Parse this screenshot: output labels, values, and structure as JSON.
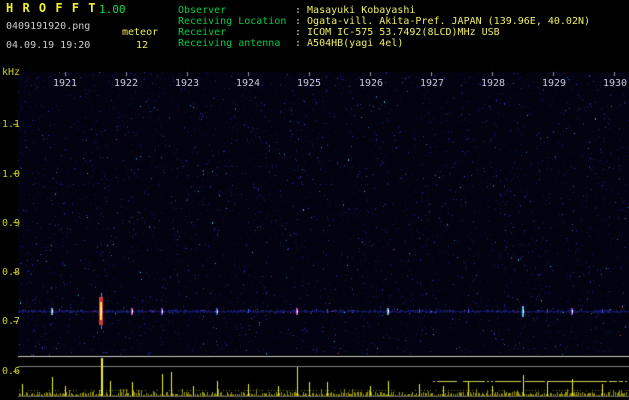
{
  "app": {
    "title": "H R O F F T",
    "version": "1.00",
    "filename": "0409191920.png",
    "mode": "meteor",
    "timestamp": "04.09.19 19:20",
    "event_count": "12"
  },
  "info": {
    "rows": [
      {
        "label": "Observer",
        "value": ": Masayuki Kobayashi"
      },
      {
        "label": "Receiving Location",
        "value": ": Ogata-vill. Akita-Pref. JAPAN (139.96E, 40.02N)"
      },
      {
        "label": "Receiver",
        "value": ": ICOM IC-575 53.7492(8LCD)MHz USB"
      },
      {
        "label": "Receiving antenna",
        "value": ": A504HB(yagi 4el)"
      }
    ]
  },
  "colors": {
    "title_yellow": "#eeee33",
    "label_green": "#00cc44",
    "value_yellow": "#eeee66",
    "axis_yellow": "#cccc22",
    "time_label": "#c8c8dc",
    "spike_yellow": "#eeee22",
    "separator": "#cccccc"
  },
  "chart_data": {
    "type": "heatmap",
    "title": "HROFFT 10-minute meteor radio spectrogram 19:20-19:30 with signal-level strip",
    "x_axis": {
      "unit": "hhmm",
      "tick_labels": [
        "1921",
        "1922",
        "1923",
        "1924",
        "1925",
        "1926",
        "1927",
        "1928",
        "1929",
        "1930"
      ]
    },
    "y_axis": {
      "unit": "kHz",
      "tick_labels": [
        "1.1",
        "1.0",
        "0.9",
        "0.8",
        "0.7",
        "0.6"
      ],
      "tick_values": [
        1.1,
        1.0,
        0.9,
        0.8,
        0.7,
        0.6
      ],
      "range_khz": [
        0.59,
        1.17
      ]
    },
    "carrier_freq_khz": 0.72,
    "echoes": [
      {
        "time": 1920.8,
        "freq_khz": 0.72,
        "strength": "small",
        "color": "cyan"
      },
      {
        "time": 1921.6,
        "freq_khz": 0.72,
        "strength": "large",
        "color": "red"
      },
      {
        "time": 1922.1,
        "freq_khz": 0.72,
        "strength": "small",
        "color": "magenta"
      },
      {
        "time": 1922.6,
        "freq_khz": 0.72,
        "strength": "small",
        "color": "purple"
      },
      {
        "time": 1923.5,
        "freq_khz": 0.72,
        "strength": "small",
        "color": "blue"
      },
      {
        "time": 1924.0,
        "freq_khz": 0.72,
        "strength": "faint",
        "color": "blue"
      },
      {
        "time": 1924.8,
        "freq_khz": 0.72,
        "strength": "small",
        "color": "magenta"
      },
      {
        "time": 1925.3,
        "freq_khz": 0.72,
        "strength": "faint",
        "color": "blue"
      },
      {
        "time": 1926.3,
        "freq_khz": 0.72,
        "strength": "small",
        "color": "cyan"
      },
      {
        "time": 1926.8,
        "freq_khz": 0.72,
        "strength": "faint",
        "color": "blue"
      },
      {
        "time": 1927.6,
        "freq_khz": 0.72,
        "strength": "faint",
        "color": "blue"
      },
      {
        "time": 1928.5,
        "freq_khz": 0.72,
        "strength": "medium",
        "color": "cyan"
      },
      {
        "time": 1928.9,
        "freq_khz": 0.72,
        "strength": "faint",
        "color": "blue"
      },
      {
        "time": 1929.3,
        "freq_khz": 0.72,
        "strength": "small",
        "color": "purple"
      },
      {
        "time": 1929.8,
        "freq_khz": 0.72,
        "strength": "faint",
        "color": "blue"
      }
    ],
    "amplitude": {
      "spikes": [
        {
          "time": 1920.3,
          "level": 0.25
        },
        {
          "time": 1920.8,
          "level": 0.45
        },
        {
          "time": 1921.0,
          "level": 0.2
        },
        {
          "time": 1921.6,
          "level": 1.0
        },
        {
          "time": 1921.75,
          "level": 0.35
        },
        {
          "time": 1922.1,
          "level": 0.3
        },
        {
          "time": 1922.6,
          "level": 0.55
        },
        {
          "time": 1922.75,
          "level": 0.6
        },
        {
          "time": 1923.1,
          "level": 0.2
        },
        {
          "time": 1923.5,
          "level": 0.35
        },
        {
          "time": 1924.0,
          "level": 0.25
        },
        {
          "time": 1924.5,
          "level": 0.2
        },
        {
          "time": 1924.8,
          "level": 0.75
        },
        {
          "time": 1925.0,
          "level": 0.3
        },
        {
          "time": 1925.3,
          "level": 0.3
        },
        {
          "time": 1926.0,
          "level": 0.2
        },
        {
          "time": 1926.3,
          "level": 0.35
        },
        {
          "time": 1926.8,
          "level": 0.25
        },
        {
          "time": 1927.2,
          "level": 0.2
        },
        {
          "time": 1927.6,
          "level": 0.3
        },
        {
          "time": 1928.0,
          "level": 0.2
        },
        {
          "time": 1928.5,
          "level": 0.5
        },
        {
          "time": 1928.9,
          "level": 0.3
        },
        {
          "time": 1929.3,
          "level": 0.4
        },
        {
          "time": 1929.8,
          "level": 0.25
        }
      ],
      "noise_floor_level": 0.12,
      "elevated_floor": {
        "from_time": 1927.0,
        "to_time": 1930.0,
        "level": 0.4
      }
    }
  }
}
